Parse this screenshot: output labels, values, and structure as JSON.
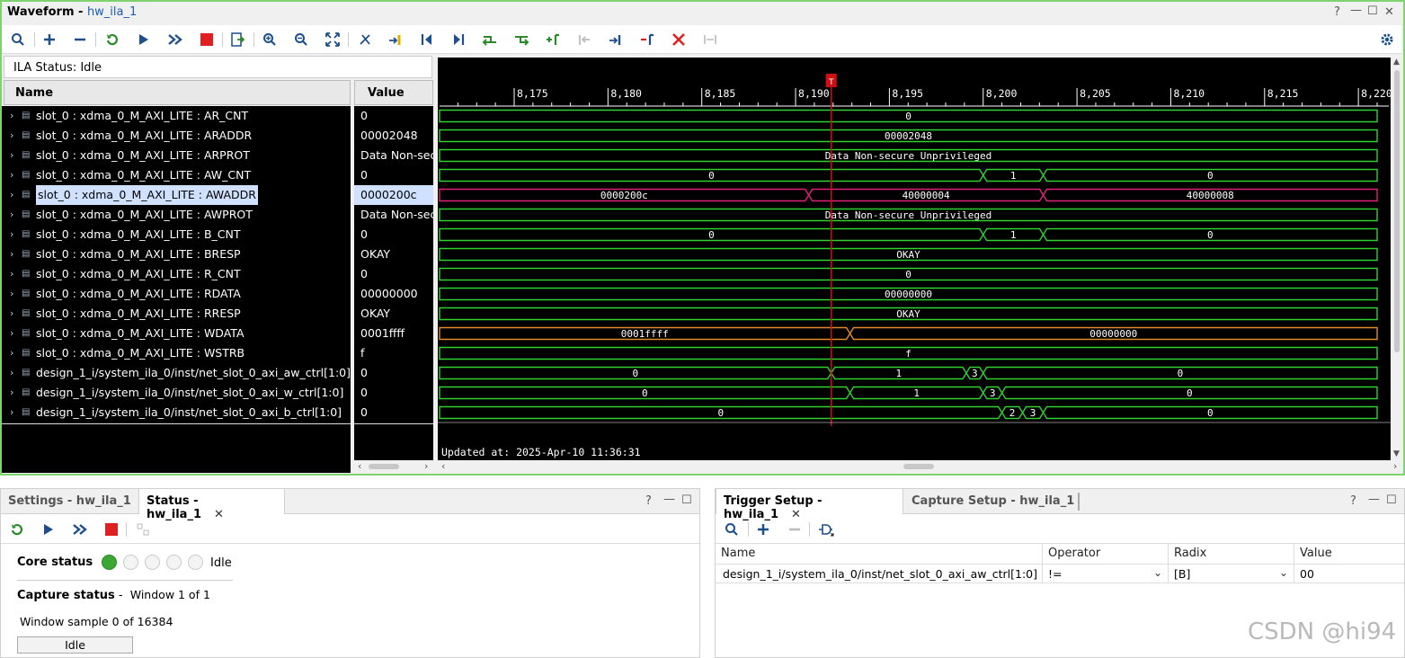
{
  "window": {
    "title": "Waveform - ",
    "subtitle": "hw_ila_1",
    "controls": [
      "?",
      "—",
      "☐",
      "✕"
    ]
  },
  "toolbar_icons": [
    "search-icon",
    "add-icon",
    "remove-icon",
    "refresh-icon",
    "run-icon",
    "run-all-icon",
    "stop-icon",
    "export-icon",
    "zoom-in-icon",
    "zoom-out-icon",
    "zoom-fit-icon",
    "cursor-icon",
    "add-marker-icon",
    "go-start-icon",
    "go-end-icon",
    "prev-edge-icon",
    "next-edge-icon",
    "add-marker2-icon",
    "prev-marker-icon",
    "next-marker-icon",
    "remove-marker-icon",
    "delete-icon",
    "swap-icon",
    "settings-icon"
  ],
  "ila_status": "ILA Status:  Idle",
  "columns": {
    "name": "Name",
    "value": "Value"
  },
  "signals": [
    {
      "name": "slot_0 : xdma_0_M_AXI_LITE : AR_CNT",
      "value": "0"
    },
    {
      "name": "slot_0 : xdma_0_M_AXI_LITE : ARADDR",
      "value": "00002048"
    },
    {
      "name": "slot_0 : xdma_0_M_AXI_LITE : ARPROT",
      "value": "Data Non-sec"
    },
    {
      "name": "slot_0 : xdma_0_M_AXI_LITE : AW_CNT",
      "value": "0"
    },
    {
      "name": "slot_0 : xdma_0_M_AXI_LITE : AWADDR",
      "value": "0000200c"
    },
    {
      "name": "slot_0 : xdma_0_M_AXI_LITE : AWPROT",
      "value": "Data Non-sec"
    },
    {
      "name": "slot_0 : xdma_0_M_AXI_LITE : B_CNT",
      "value": "0"
    },
    {
      "name": "slot_0 : xdma_0_M_AXI_LITE : BRESP",
      "value": "OKAY"
    },
    {
      "name": "slot_0 : xdma_0_M_AXI_LITE : R_CNT",
      "value": "0"
    },
    {
      "name": "slot_0 : xdma_0_M_AXI_LITE : RDATA",
      "value": "00000000"
    },
    {
      "name": "slot_0 : xdma_0_M_AXI_LITE : RRESP",
      "value": "OKAY"
    },
    {
      "name": "slot_0 : xdma_0_M_AXI_LITE : WDATA",
      "value": "0001ffff"
    },
    {
      "name": "slot_0 : xdma_0_M_AXI_LITE : WSTRB",
      "value": "f"
    },
    {
      "name": "design_1_i/system_ila_0/inst/net_slot_0_axi_aw_ctrl[1:0]",
      "value": "0"
    },
    {
      "name": "design_1_i/system_ila_0/inst/net_slot_0_axi_w_ctrl[1:0]",
      "value": "0"
    },
    {
      "name": "design_1_i/system_ila_0/inst/net_slot_0_axi_b_ctrl[1:0]",
      "value": "0"
    }
  ],
  "selected_signal": 4,
  "waveform": {
    "ticks": [
      "8,175",
      "8,180",
      "8,185",
      "8,190",
      "8,195",
      "8,200",
      "8,205",
      "8,210",
      "8,215",
      "8,220"
    ],
    "tick_start": 8175,
    "tick_step": 5,
    "trigger_marker": "T",
    "trigger_sample": 8191.9,
    "updated": "Updated at: 2025-Apr-10 11:36:31",
    "colors": {
      "bus": "#2fd02f",
      "selected": "#e0207a",
      "orange": "#e08a2a",
      "cursor": "#d01010",
      "text": "#ffffff"
    },
    "tracks": [
      {
        "segs": [
          {
            "from": 8171,
            "to": 8221,
            "label": "0"
          }
        ]
      },
      {
        "segs": [
          {
            "from": 8171,
            "to": 8221,
            "label": "00002048"
          }
        ]
      },
      {
        "segs": [
          {
            "from": 8171,
            "to": 8221,
            "label": "Data Non-secure Unprivileged"
          }
        ]
      },
      {
        "segs": [
          {
            "from": 8171,
            "to": 8200,
            "label": "0"
          },
          {
            "from": 8200,
            "to": 8203.2,
            "label": "1"
          },
          {
            "from": 8203.2,
            "to": 8221,
            "label": "0"
          }
        ]
      },
      {
        "color": "selected",
        "segs": [
          {
            "from": 8171,
            "to": 8190.7,
            "label": "0000200c"
          },
          {
            "from": 8190.7,
            "to": 8203.2,
            "label": "40000004"
          },
          {
            "from": 8203.2,
            "to": 8221,
            "label": "40000008"
          }
        ]
      },
      {
        "segs": [
          {
            "from": 8171,
            "to": 8221,
            "label": "Data Non-secure Unprivileged"
          }
        ]
      },
      {
        "segs": [
          {
            "from": 8171,
            "to": 8200,
            "label": "0"
          },
          {
            "from": 8200,
            "to": 8203.2,
            "label": "1"
          },
          {
            "from": 8203.2,
            "to": 8221,
            "label": "0"
          }
        ]
      },
      {
        "segs": [
          {
            "from": 8171,
            "to": 8221,
            "label": "OKAY"
          }
        ]
      },
      {
        "segs": [
          {
            "from": 8171,
            "to": 8221,
            "label": "0"
          }
        ]
      },
      {
        "segs": [
          {
            "from": 8171,
            "to": 8221,
            "label": "00000000"
          }
        ]
      },
      {
        "segs": [
          {
            "from": 8171,
            "to": 8221,
            "label": "OKAY"
          }
        ]
      },
      {
        "color": "orange",
        "segs": [
          {
            "from": 8171,
            "to": 8192.9,
            "label": "0001ffff"
          },
          {
            "from": 8192.9,
            "to": 8221,
            "label": "00000000"
          }
        ]
      },
      {
        "segs": [
          {
            "from": 8171,
            "to": 8221,
            "label": "f"
          }
        ]
      },
      {
        "segs": [
          {
            "from": 8171,
            "to": 8191.9,
            "label": "0"
          },
          {
            "from": 8191.9,
            "to": 8199.1,
            "label": "1"
          },
          {
            "from": 8199.1,
            "to": 8200,
            "label": "3"
          },
          {
            "from": 8200,
            "to": 8221,
            "label": "0"
          }
        ]
      },
      {
        "segs": [
          {
            "from": 8171,
            "to": 8192.9,
            "label": "0"
          },
          {
            "from": 8192.9,
            "to": 8200,
            "label": "1"
          },
          {
            "from": 8200,
            "to": 8201,
            "label": "3"
          },
          {
            "from": 8201,
            "to": 8221,
            "label": "0"
          }
        ]
      },
      {
        "segs": [
          {
            "from": 8171,
            "to": 8201,
            "label": "0"
          },
          {
            "from": 8201,
            "to": 8202.1,
            "label": "2"
          },
          {
            "from": 8202.1,
            "to": 8203.2,
            "label": "3"
          },
          {
            "from": 8203.2,
            "to": 8221,
            "label": "0"
          }
        ]
      }
    ]
  },
  "left_panel": {
    "tab_settings": "Settings - hw_ila_1",
    "tab_status": "Status - hw_ila_1",
    "close": "✕",
    "controls": [
      "?",
      "—",
      "☐"
    ],
    "core_status_label": "Core status",
    "core_status_value": "Idle",
    "capture_status_label": "Capture status",
    "capture_status_sep": " - ",
    "capture_status_window": "Window 1 of 1",
    "window_sample": "Window sample 0 of 16384",
    "idle_button": "Idle"
  },
  "right_panel": {
    "tab_trigger": "Trigger Setup - hw_ila_1",
    "tab_capture": "Capture Setup - hw_ila_1",
    "close": "✕",
    "controls": [
      "?",
      "—",
      "☐"
    ],
    "headers": [
      "Name",
      "Operator",
      "Radix",
      "Value"
    ],
    "row": {
      "name": "design_1_i/system_ila_0/inst/net_slot_0_axi_aw_ctrl[1:0]",
      "operator": "!=",
      "radix": "[B]",
      "value": "00"
    }
  },
  "watermark": "CSDN @hi94"
}
